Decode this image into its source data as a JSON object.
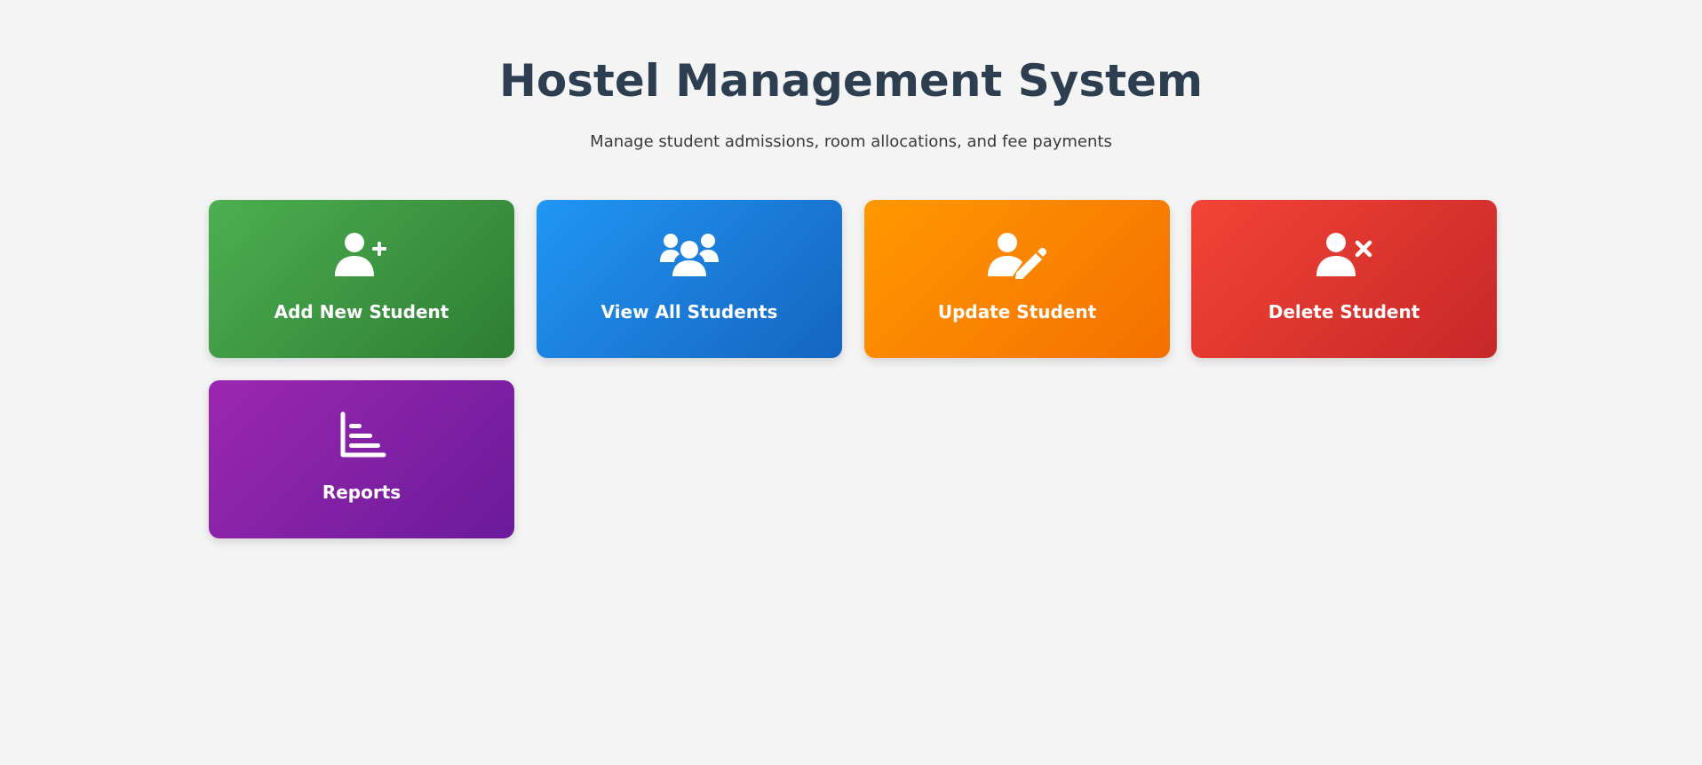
{
  "header": {
    "title": "Hostel Management System",
    "subtitle": "Manage student admissions, room allocations, and fee payments"
  },
  "cards": [
    {
      "label": "Add New Student",
      "icon": "user-plus-icon",
      "color": "#43a047"
    },
    {
      "label": "View All Students",
      "icon": "users-icon",
      "color": "#1e88e5"
    },
    {
      "label": "Update Student",
      "icon": "user-edit-icon",
      "color": "#fb8c00"
    },
    {
      "label": "Delete Student",
      "icon": "user-delete-icon",
      "color": "#e53935"
    },
    {
      "label": "Reports",
      "icon": "bar-chart-icon",
      "color": "#8e24aa"
    }
  ]
}
